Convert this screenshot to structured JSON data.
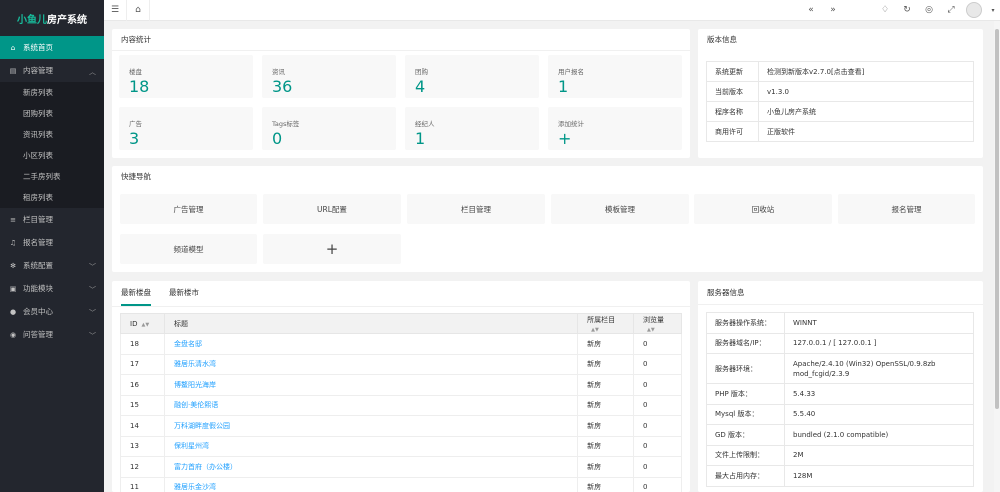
{
  "app": {
    "logo_a": "小鱼儿",
    "logo_b": "房产系统"
  },
  "sidebar": {
    "items": [
      {
        "label": "系统首页",
        "icon": "home-icon"
      },
      {
        "label": "内容管理",
        "icon": "document-icon"
      },
      {
        "label": "栏目管理",
        "icon": "layers-icon"
      },
      {
        "label": "报名管理",
        "icon": "bell-icon"
      },
      {
        "label": "系统配置",
        "icon": "gear-icon"
      },
      {
        "label": "功能模块",
        "icon": "folder-icon"
      },
      {
        "label": "会员中心",
        "icon": "user-icon"
      },
      {
        "label": "问答管理",
        "icon": "chat-icon"
      }
    ],
    "sub": [
      "新房列表",
      "团购列表",
      "资讯列表",
      "小区列表",
      "二手房列表",
      "租房列表"
    ]
  },
  "content_stats": {
    "title": "内容统计",
    "items": [
      {
        "label": "楼盘",
        "value": "18"
      },
      {
        "label": "资讯",
        "value": "36"
      },
      {
        "label": "团购",
        "value": "4"
      },
      {
        "label": "用户报名",
        "value": "1"
      },
      {
        "label": "广告",
        "value": "3"
      },
      {
        "label": "Tags标签",
        "value": "0"
      },
      {
        "label": "经纪人",
        "value": "1"
      },
      {
        "label": "添加统计",
        "value": "+"
      }
    ]
  },
  "version": {
    "title": "版本信息",
    "rows": [
      {
        "k": "系统更新",
        "v": "检测到新版本v2.7.0[点击查看]"
      },
      {
        "k": "当前版本",
        "v": "v1.3.0"
      },
      {
        "k": "程序名称",
        "v": "小鱼儿房产系统"
      },
      {
        "k": "商用许可",
        "v": "正版软件"
      }
    ]
  },
  "quick_nav": {
    "title": "快捷导航",
    "items": [
      "广告管理",
      "URL配置",
      "栏目管理",
      "模板管理",
      "回收站",
      "报名管理",
      "频道模型",
      "+"
    ]
  },
  "listing": {
    "tabs": [
      "最新楼盘",
      "最新楼市"
    ],
    "headers": [
      "ID",
      "标题",
      "所属栏目",
      "浏览量"
    ],
    "rows": [
      [
        "18",
        "金盘名邸",
        "新房",
        "0"
      ],
      [
        "17",
        "雅居乐清水湾",
        "新房",
        "0"
      ],
      [
        "16",
        "博鳌阳光海岸",
        "新房",
        "0"
      ],
      [
        "15",
        "融创·美伦熙语",
        "新房",
        "0"
      ],
      [
        "14",
        "万科湖畔度假公园",
        "新房",
        "0"
      ],
      [
        "13",
        "保利星州湾",
        "新房",
        "0"
      ],
      [
        "12",
        "富力首府（办公楼）",
        "新房",
        "0"
      ],
      [
        "11",
        "雅居乐金沙湾",
        "新房",
        "0"
      ]
    ]
  },
  "server": {
    "title": "服务器信息",
    "rows": [
      {
        "k": "服务器操作系统：",
        "v": "WINNT"
      },
      {
        "k": "服务器域名/IP：",
        "v": "127.0.0.1 / [ 127.0.0.1 ]"
      },
      {
        "k": "服务器环境：",
        "v": "Apache/2.4.10 (Win32) OpenSSL/0.9.8zb mod_fcgid/2.3.9"
      },
      {
        "k": "PHP 版本：",
        "v": "5.4.33"
      },
      {
        "k": "Mysql 版本：",
        "v": "5.5.40"
      },
      {
        "k": "GD 版本：",
        "v": "bundled (2.1.0 compatible)"
      },
      {
        "k": "文件上传限制：",
        "v": "2M"
      },
      {
        "k": "最大占用内存：",
        "v": "128M"
      }
    ]
  }
}
